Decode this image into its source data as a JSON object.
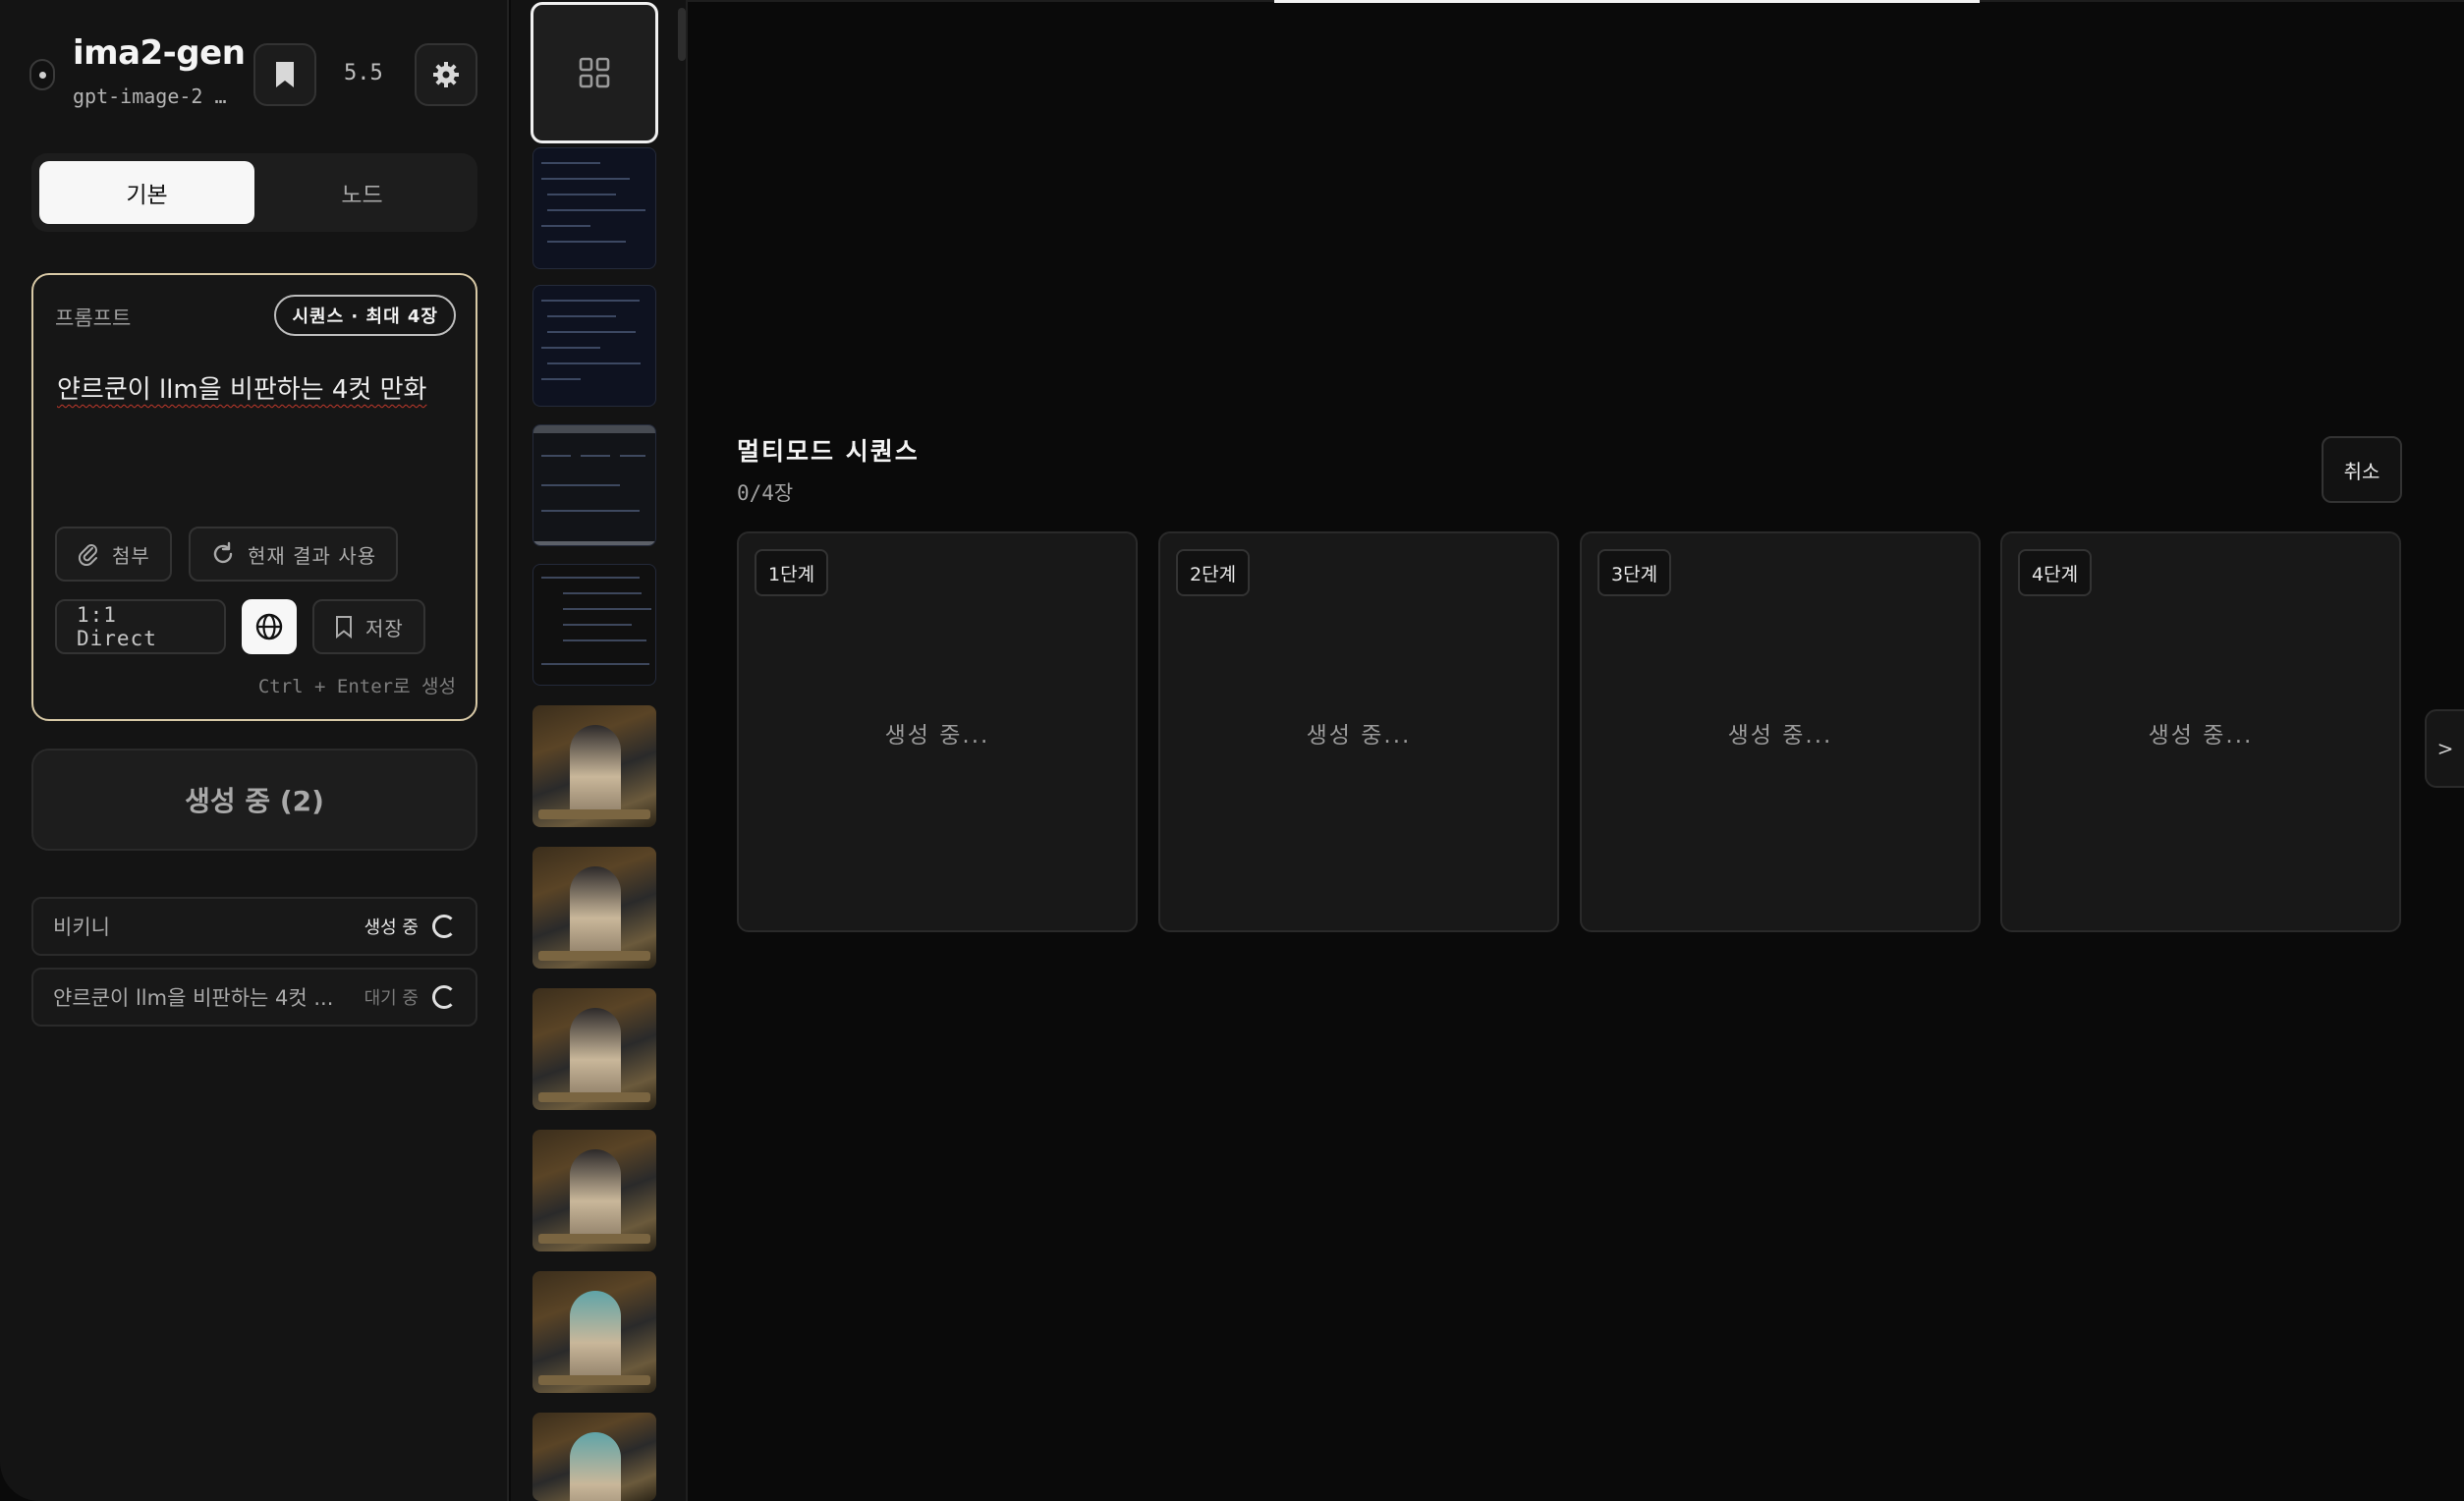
{
  "app": {
    "title": "ima2-gen",
    "subtitle": "gpt-image-2 …",
    "version": "5.5"
  },
  "mode_tabs": [
    {
      "label": "기본",
      "active": true
    },
    {
      "label": "노드",
      "active": false
    }
  ],
  "prompt": {
    "label": "프롬프트",
    "badge": "시퀀스 · 최대 4장",
    "text": "얀르쿤이 llm을 비판하는 4컷 만화",
    "attach_label": "첨부",
    "use_result_label": "현재 결과 사용",
    "ratio_label": "1:1 Direct",
    "save_label": "저장",
    "shortcut_hint": "Ctrl + Enter로 생성"
  },
  "generate_button": "생성 중 (2)",
  "queue": [
    {
      "label": "비키니",
      "status": "생성 중",
      "status_color": "#e8e8e8"
    },
    {
      "label": "얀르쿤이 llm을 비판하는 4컷 ...",
      "status": "대기 중",
      "status_color": "#7a7a7a"
    }
  ],
  "thumbnails": {
    "code_count": 4,
    "art": [
      "dark",
      "dark",
      "dark",
      "dark",
      "teal",
      "teal"
    ]
  },
  "sequence": {
    "title": "멀티모드 시퀀스",
    "count": "0/4장",
    "cancel_label": "취소",
    "steps": [
      {
        "label": "1단계",
        "status": "생성 중..."
      },
      {
        "label": "2단계",
        "status": "생성 중..."
      },
      {
        "label": "3단계",
        "status": "생성 중..."
      },
      {
        "label": "4단계",
        "status": "생성 중..."
      }
    ]
  },
  "side_toggle": ">",
  "colors": {
    "accent_border": "#d8c9a6",
    "background": "#0a0a0a",
    "panel": "#141414"
  }
}
